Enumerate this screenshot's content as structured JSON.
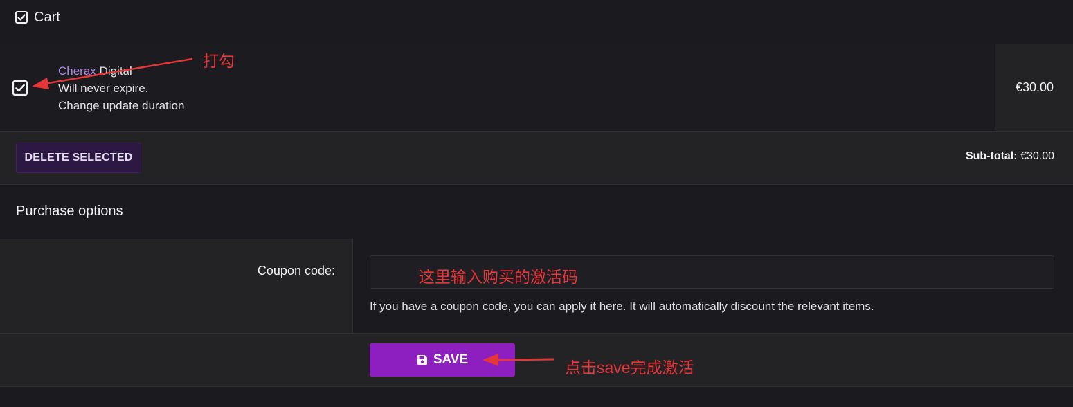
{
  "cart": {
    "title": "Cart",
    "checked": true
  },
  "item": {
    "name_brand": "Cherax",
    "name_rest": " Digital",
    "expiry": "Will never expire.",
    "change_link": "Change update duration",
    "price": "€30.00",
    "checked": true
  },
  "actions": {
    "delete_label": "DELETE SELECTED",
    "subtotal_label": "Sub-total:",
    "subtotal_value": "€30.00"
  },
  "purchase": {
    "title": "Purchase options",
    "coupon_label": "Coupon code:",
    "coupon_value": "",
    "coupon_help": "If you have a coupon code, you can apply it here. It will automatically discount the relevant items.",
    "save_label": "SAVE"
  },
  "annotations": {
    "check_note": "打勾",
    "coupon_note": "这里输入购买的激活码",
    "save_note": "点击save完成激活"
  },
  "colors": {
    "background": "#1b1a1e",
    "panel": "#232325",
    "brand_purple": "#b18ce6",
    "save_button": "#8d1fc0",
    "delete_button": "#2d1844",
    "annotation_red": "#e5373a"
  }
}
